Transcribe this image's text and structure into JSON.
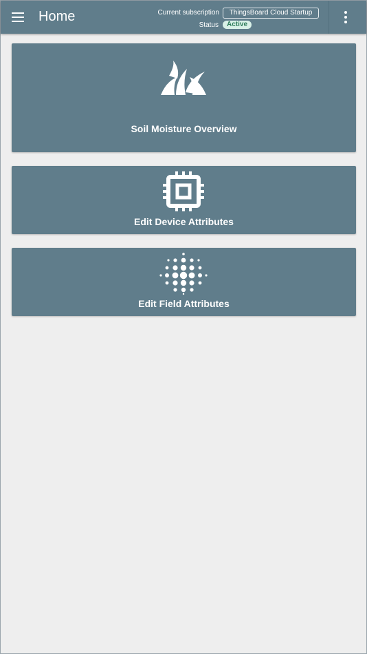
{
  "header": {
    "title": "Home",
    "subscription_label": "Current subscription",
    "subscription_value": "ThingsBoard Cloud Startup",
    "status_label": "Status",
    "status_value": "Active",
    "menu_icon": "menu-icon",
    "more_icon": "more-vert-icon"
  },
  "cards": [
    {
      "label": "Soil Moisture Overview",
      "icon": "grass-icon"
    },
    {
      "label": "Edit Device Attributes",
      "icon": "chip-icon"
    },
    {
      "label": "Edit Field Attributes",
      "icon": "dots-radial-icon"
    }
  ],
  "colors": {
    "primary": "#607d8b",
    "background": "#eeeeee",
    "status_bg": "#d9f1e8",
    "status_text": "#2e7d5b"
  }
}
